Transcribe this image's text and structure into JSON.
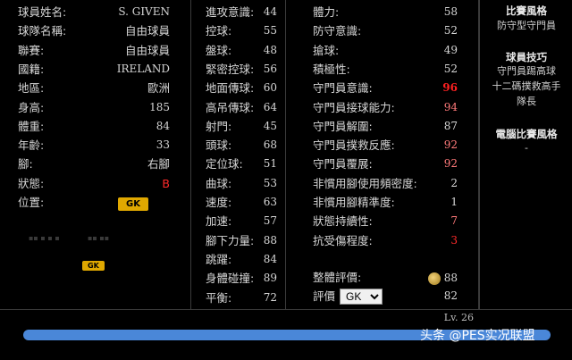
{
  "profile": [
    {
      "label": "球員姓名:",
      "value": "S. GIVEN",
      "style": "mono"
    },
    {
      "label": "球隊名稱:",
      "value": "自由球員",
      "style": ""
    },
    {
      "label": "聯賽:",
      "value": "自由球員",
      "style": ""
    },
    {
      "label": "國籍:",
      "value": "IRELAND",
      "style": "mono"
    },
    {
      "label": "地區:",
      "value": "歐洲",
      "style": ""
    },
    {
      "label": "身高:",
      "value": "185",
      "style": "mono"
    },
    {
      "label": "體重:",
      "value": "84",
      "style": "mono"
    },
    {
      "label": "年齡:",
      "value": "33",
      "style": "mono"
    },
    {
      "label": "腳:",
      "value": "右腳",
      "style": ""
    },
    {
      "label": "狀態:",
      "value": "B",
      "style": "red"
    },
    {
      "label": "位置:",
      "value": "GK",
      "style": "badge"
    }
  ],
  "position_badge_small": "GK",
  "attributes_mid": [
    {
      "label": "進攻意識:",
      "value": "44"
    },
    {
      "label": "控球:",
      "value": "55"
    },
    {
      "label": "盤球:",
      "value": "48"
    },
    {
      "label": "緊密控球:",
      "value": "56"
    },
    {
      "label": "地面傳球:",
      "value": "60"
    },
    {
      "label": "高吊傳球:",
      "value": "64"
    },
    {
      "label": "射門:",
      "value": "45"
    },
    {
      "label": "頭球:",
      "value": "68"
    },
    {
      "label": "定位球:",
      "value": "51"
    },
    {
      "label": "曲球:",
      "value": "53"
    },
    {
      "label": "速度:",
      "value": "63"
    },
    {
      "label": "加速:",
      "value": "57"
    },
    {
      "label": "腳下力量:",
      "value": "88"
    },
    {
      "label": "跳躍:",
      "value": "84"
    },
    {
      "label": "身體碰撞:",
      "value": "89"
    },
    {
      "label": "平衡:",
      "value": "72"
    }
  ],
  "attributes_right": [
    {
      "label": "體力:",
      "value": "58",
      "style": ""
    },
    {
      "label": "防守意識:",
      "value": "52",
      "style": ""
    },
    {
      "label": "搶球:",
      "value": "49",
      "style": ""
    },
    {
      "label": "積極性:",
      "value": "52",
      "style": ""
    },
    {
      "label": "守門員意識:",
      "value": "96",
      "style": "redval"
    },
    {
      "label": "守門員接球能力:",
      "value": "94",
      "style": "pink"
    },
    {
      "label": "守門員解圍:",
      "value": "87",
      "style": ""
    },
    {
      "label": "守門員撲救反應:",
      "value": "92",
      "style": "pink"
    },
    {
      "label": "守門員覆展:",
      "value": "92",
      "style": "pink"
    },
    {
      "label": "非慣用腳使用頻密度:",
      "value": "2",
      "style": ""
    },
    {
      "label": "非慣用腳精準度:",
      "value": "1",
      "style": ""
    },
    {
      "label": "狀態持續性:",
      "value": "7",
      "style": "pink"
    },
    {
      "label": "抗受傷程度:",
      "value": "3",
      "style": "red"
    }
  ],
  "overall": {
    "label": "整體評價:",
    "value": "88"
  },
  "rating": {
    "label": "評價",
    "selected": "GK",
    "value": "82"
  },
  "side": {
    "style_title": "比賽風格",
    "style_value": "防守型守門員",
    "skills_title": "球員技巧",
    "skills": [
      "守門員踢高球",
      "十二碼撲救高手",
      "隊長"
    ],
    "ai_title": "電腦比賽風格",
    "ai_value": "-"
  },
  "level": "Lv. 26",
  "progress_fraction": 1.0,
  "watermark": "头条 @PES实况联盟"
}
